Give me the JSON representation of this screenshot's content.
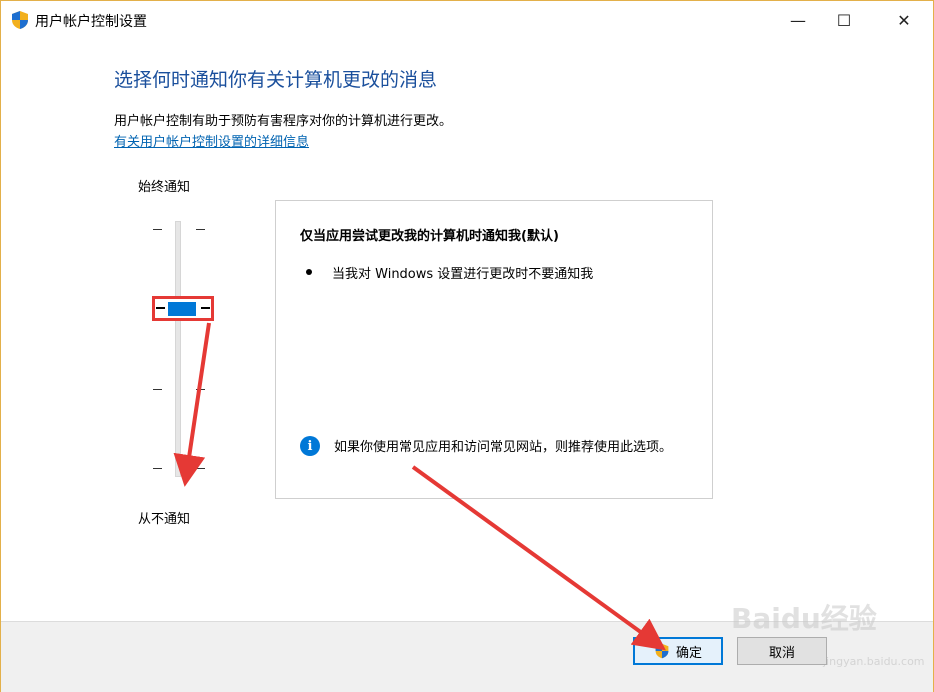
{
  "window": {
    "title": "用户帐户控制设置",
    "controls": {
      "minimize": "—",
      "maximize": "☐",
      "close": "✕"
    }
  },
  "heading": "选择何时通知你有关计算机更改的消息",
  "description": "用户帐户控制有助于预防有害程序对你的计算机进行更改。",
  "more_link": "有关用户帐户控制设置的详细信息",
  "slider": {
    "label_top": "始终通知",
    "label_bottom": "从不通知",
    "levels": 4,
    "selected_level_from_bottom": 3
  },
  "panel": {
    "title": "仅当应用尝试更改我的计算机时通知我(默认)",
    "bullet": "当我对 Windows 设置进行更改时不要通知我",
    "info_icon_glyph": "i",
    "recommendation": "如果你使用常见应用和访问常见网站，则推荐使用此选项。"
  },
  "buttons": {
    "ok": "确定",
    "cancel": "取消"
  },
  "watermark": {
    "text": "Baidu经验",
    "sub": "jingyan.baidu.com"
  },
  "colors": {
    "accent": "#0078d7",
    "heading": "#1a4f9c",
    "annotation": "#e53935",
    "window_border": "#e3b04a"
  },
  "icons": {
    "title": "uac-shield-icon",
    "ok": "uac-shield-icon",
    "info": "info-icon"
  }
}
